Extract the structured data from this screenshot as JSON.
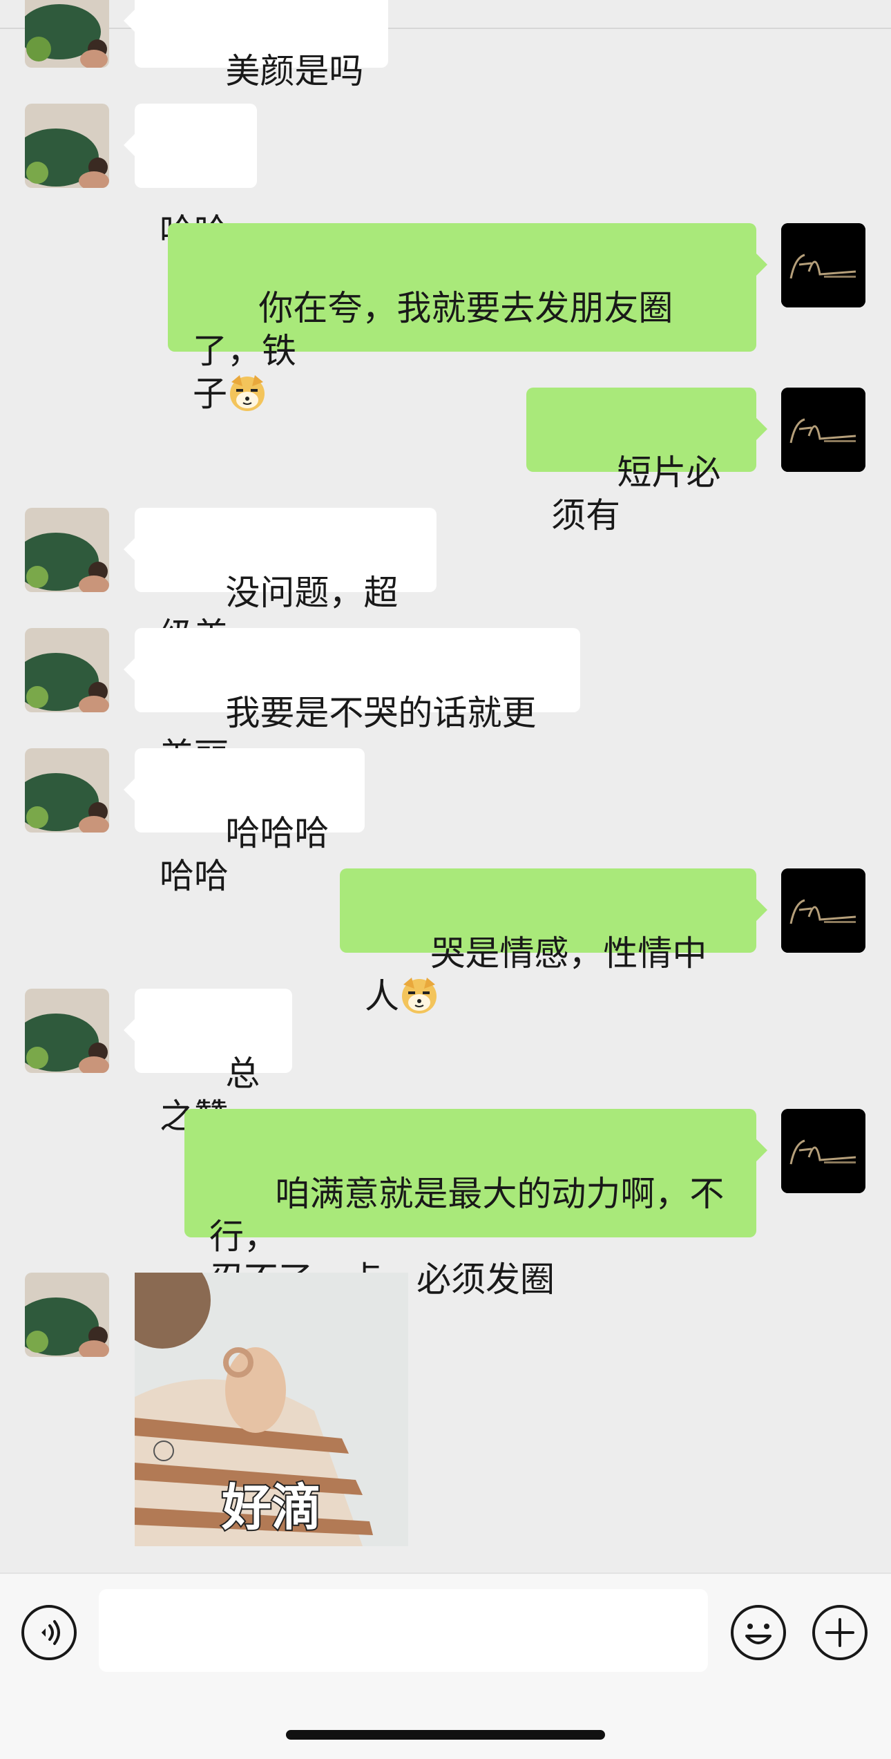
{
  "messages": [
    {
      "side": "in",
      "text": "美颜是吗"
    },
    {
      "side": "in",
      "text": "哈哈"
    },
    {
      "side": "out",
      "text": "你在夸，我就要去发朋友圈了，铁\n子",
      "emoji": "doge-emoji"
    },
    {
      "side": "out",
      "text": "短片必须有"
    },
    {
      "side": "in",
      "text": "没问题，超级美"
    },
    {
      "side": "in",
      "text": "我要是不哭的话就更美丽"
    },
    {
      "side": "in",
      "text": "哈哈哈哈哈"
    },
    {
      "side": "out",
      "text": "哭是情感，性情中人",
      "emoji": "doge-emoji"
    },
    {
      "side": "in",
      "text": "总之赞"
    },
    {
      "side": "out",
      "text": "咱满意就是最大的动力啊，不行，\n忍不了一点，必须发圈"
    },
    {
      "side": "in",
      "type": "sticker",
      "text": "好滴"
    }
  ],
  "input": {
    "value": "",
    "placeholder": ""
  },
  "icons": {
    "voice": "voice-icon",
    "emoji": "emoji-icon",
    "plus": "plus-icon"
  },
  "colors": {
    "background": "#ededed",
    "outgoing_bubble": "#a9e97a",
    "incoming_bubble": "#ffffff",
    "input_bar": "#f7f7f7"
  }
}
